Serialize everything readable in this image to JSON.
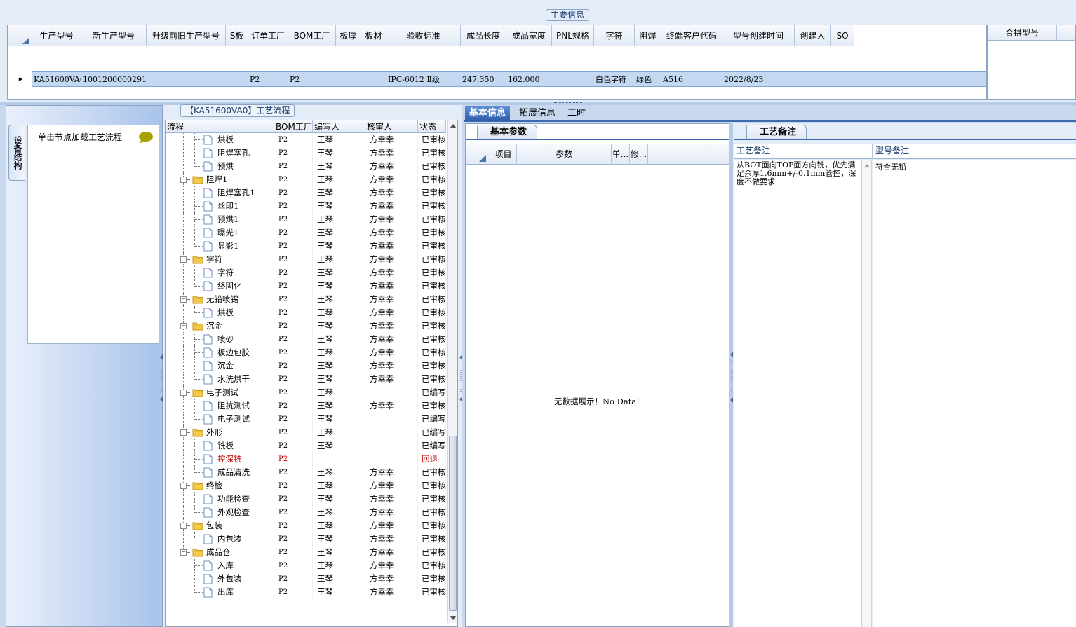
{
  "main_info": {
    "title": "主要信息",
    "columns": [
      "生产型号",
      "新生产型号",
      "升级前旧生产型号",
      "S板",
      "订单工厂",
      "BOM工厂",
      "板厚",
      "板材",
      "验收标准",
      "成品长度",
      "成品宽度",
      "PNL规格",
      "字符",
      "阻焊",
      "终端客户代码",
      "型号创建时间",
      "创建人",
      "SO"
    ],
    "row": {
      "production_model": "KA51600VA0",
      "new_production_model": "10012000002913",
      "old_model": "",
      "s_board": "",
      "order_factory": "P2",
      "bom_factory": "P2",
      "thickness": "",
      "material": "",
      "acceptance_standard": "IPC-6012 Ⅱ级",
      "length": "247.350",
      "width": "162.000",
      "pnl_spec": "",
      "character": "白色字符",
      "solder_mask": "绿色",
      "end_customer_code": "A516",
      "create_time": "2022/8/23",
      "creator": "",
      "so": ""
    },
    "merge_model_label": "合拼型号"
  },
  "left_nav": {
    "vtab_label": "设备结构",
    "hint": "单击节点加载工艺流程"
  },
  "flow": {
    "title": "【KA51600VA0】工艺流程",
    "columns": [
      "流程",
      "BOM工厂",
      "编写人",
      "核审人",
      "状态"
    ],
    "rows": [
      {
        "name": "烘板",
        "type": "leaf",
        "bom": "P2",
        "writer": "王琴",
        "reviewer": "方幸幸",
        "status": "已审核"
      },
      {
        "name": "阻焊塞孔",
        "type": "leaf",
        "bom": "P2",
        "writer": "王琴",
        "reviewer": "方幸幸",
        "status": "已审核"
      },
      {
        "name": "预烘",
        "type": "leaf-last",
        "bom": "P2",
        "writer": "王琴",
        "reviewer": "方幸幸",
        "status": "已审核"
      },
      {
        "name": "阻焊1",
        "type": "folder",
        "bom": "P2",
        "writer": "王琴",
        "reviewer": "方幸幸",
        "status": "已审核"
      },
      {
        "name": "阻焊塞孔1",
        "type": "leaf",
        "bom": "P2",
        "writer": "王琴",
        "reviewer": "方幸幸",
        "status": "已审核"
      },
      {
        "name": "丝印1",
        "type": "leaf",
        "bom": "P2",
        "writer": "王琴",
        "reviewer": "方幸幸",
        "status": "已审核"
      },
      {
        "name": "预烘1",
        "type": "leaf",
        "bom": "P2",
        "writer": "王琴",
        "reviewer": "方幸幸",
        "status": "已审核"
      },
      {
        "name": "曝光1",
        "type": "leaf",
        "bom": "P2",
        "writer": "王琴",
        "reviewer": "方幸幸",
        "status": "已审核"
      },
      {
        "name": "显影1",
        "type": "leaf-last",
        "bom": "P2",
        "writer": "王琴",
        "reviewer": "方幸幸",
        "status": "已审核"
      },
      {
        "name": "字符",
        "type": "folder",
        "bom": "P2",
        "writer": "王琴",
        "reviewer": "方幸幸",
        "status": "已审核"
      },
      {
        "name": "字符",
        "type": "leaf",
        "bom": "P2",
        "writer": "王琴",
        "reviewer": "方幸幸",
        "status": "已审核"
      },
      {
        "name": "终固化",
        "type": "leaf-last",
        "bom": "P2",
        "writer": "王琴",
        "reviewer": "方幸幸",
        "status": "已审核"
      },
      {
        "name": "无铅喷锡",
        "type": "folder",
        "bom": "P2",
        "writer": "王琴",
        "reviewer": "方幸幸",
        "status": "已审核"
      },
      {
        "name": "烘板",
        "type": "leaf-last",
        "bom": "P2",
        "writer": "王琴",
        "reviewer": "方幸幸",
        "status": "已审核"
      },
      {
        "name": "沉金",
        "type": "folder",
        "bom": "P2",
        "writer": "王琴",
        "reviewer": "方幸幸",
        "status": "已审核"
      },
      {
        "name": "喷砂",
        "type": "leaf",
        "bom": "P2",
        "writer": "王琴",
        "reviewer": "方幸幸",
        "status": "已审核"
      },
      {
        "name": "板边包胶",
        "type": "leaf",
        "bom": "P2",
        "writer": "王琴",
        "reviewer": "方幸幸",
        "status": "已审核"
      },
      {
        "name": "沉金",
        "type": "leaf",
        "bom": "P2",
        "writer": "王琴",
        "reviewer": "方幸幸",
        "status": "已审核"
      },
      {
        "name": "水洗烘干",
        "type": "leaf-last",
        "bom": "P2",
        "writer": "王琴",
        "reviewer": "方幸幸",
        "status": "已审核"
      },
      {
        "name": "电子测试",
        "type": "folder",
        "bom": "P2",
        "writer": "王琴",
        "reviewer": "",
        "status": "已编写"
      },
      {
        "name": "阻抗测试",
        "type": "leaf",
        "bom": "P2",
        "writer": "王琴",
        "reviewer": "方幸幸",
        "status": "已审核"
      },
      {
        "name": "电子测试",
        "type": "leaf-last",
        "bom": "P2",
        "writer": "王琴",
        "reviewer": "",
        "status": "已编写"
      },
      {
        "name": "外形",
        "type": "folder",
        "bom": "P2",
        "writer": "王琴",
        "reviewer": "",
        "status": "已编写"
      },
      {
        "name": "铣板",
        "type": "leaf",
        "bom": "P2",
        "writer": "王琴",
        "reviewer": "",
        "status": "已编写"
      },
      {
        "name": "控深铣",
        "type": "leaf",
        "bom": "P2",
        "writer": "",
        "reviewer": "",
        "status": "回退",
        "red": true
      },
      {
        "name": "成品清洗",
        "type": "leaf-last",
        "bom": "P2",
        "writer": "王琴",
        "reviewer": "方幸幸",
        "status": "已审核"
      },
      {
        "name": "终检",
        "type": "folder",
        "bom": "P2",
        "writer": "王琴",
        "reviewer": "方幸幸",
        "status": "已审核"
      },
      {
        "name": "功能检查",
        "type": "leaf",
        "bom": "P2",
        "writer": "王琴",
        "reviewer": "方幸幸",
        "status": "已审核"
      },
      {
        "name": "外观检查",
        "type": "leaf-last",
        "bom": "P2",
        "writer": "王琴",
        "reviewer": "方幸幸",
        "status": "已审核"
      },
      {
        "name": "包装",
        "type": "folder",
        "bom": "P2",
        "writer": "王琴",
        "reviewer": "方幸幸",
        "status": "已审核"
      },
      {
        "name": "内包装",
        "type": "leaf-last",
        "bom": "P2",
        "writer": "王琴",
        "reviewer": "方幸幸",
        "status": "已审核"
      },
      {
        "name": "成品仓",
        "type": "folder-last",
        "bom": "P2",
        "writer": "王琴",
        "reviewer": "方幸幸",
        "status": "已审核"
      },
      {
        "name": "入库",
        "type": "leaf2",
        "bom": "P2",
        "writer": "王琴",
        "reviewer": "方幸幸",
        "status": "已审核"
      },
      {
        "name": "外包装",
        "type": "leaf2",
        "bom": "P2",
        "writer": "王琴",
        "reviewer": "方幸幸",
        "status": "已审核"
      },
      {
        "name": "出库",
        "type": "leaf2-last",
        "bom": "P2",
        "writer": "王琴",
        "reviewer": "方幸幸",
        "status": "已审核"
      }
    ]
  },
  "info_tabs": [
    "基本信息",
    "拓展信息",
    "工时"
  ],
  "params": {
    "tab_label": "基本参数",
    "columns": [
      "项目",
      "参数",
      "单...",
      "修..."
    ],
    "no_data": "无数据展示！No Data!"
  },
  "remarks": {
    "tab_label": "工艺备注",
    "columns": [
      "工艺备注",
      "型号备注"
    ],
    "process_remark": "从BOT面向TOP面方向铣，优先满足余厚1.6mm+/-0.1mm管控，深度不做要求",
    "model_remark": "符合无铅"
  },
  "colors": {
    "selection": "#c4d8f2",
    "tab_active": "#2e5ea8",
    "border": "#8aa4c8",
    "rejected": "#c00000"
  }
}
